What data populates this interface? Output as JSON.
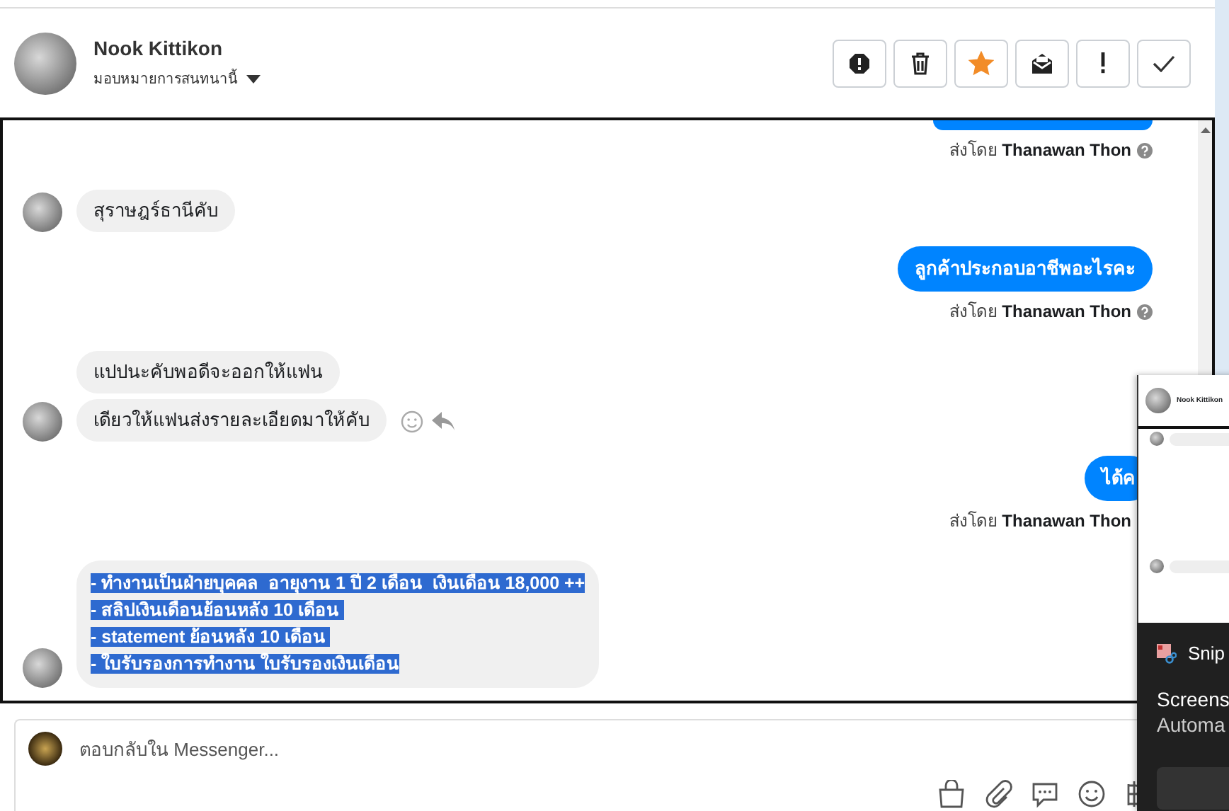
{
  "header": {
    "name": "Nook Kittikon",
    "assign_label": "มอบหมายการสนทนานี้",
    "buttons": [
      {
        "kind": "spam",
        "active": false
      },
      {
        "kind": "delete",
        "active": false
      },
      {
        "kind": "star",
        "active": true
      },
      {
        "kind": "unread",
        "active": false
      },
      {
        "kind": "important",
        "active": false
      },
      {
        "kind": "done",
        "active": false
      }
    ]
  },
  "messages": [
    {
      "kind": "sender",
      "prefix": "ส่งโดย",
      "name": "Thanawan Thon",
      "help": true
    },
    {
      "kind": "incoming",
      "avatar": true,
      "actions": false,
      "selected": false,
      "lines": [
        "สุราษฎร์ธานีคับ"
      ]
    },
    {
      "kind": "outgoing",
      "lines": [
        "ลูกค้าประกอบอาชีพอะไรคะ"
      ]
    },
    {
      "kind": "sender",
      "prefix": "ส่งโดย",
      "name": "Thanawan Thon",
      "help": true
    },
    {
      "kind": "incoming",
      "avatar": false,
      "actions": false,
      "selected": false,
      "lines": [
        "แปปนะคับพอดีจะออกให้แฟน"
      ]
    },
    {
      "kind": "incoming",
      "avatar": true,
      "actions": true,
      "selected": false,
      "lines": [
        "เดียวให้แฟนส่งรายละเอียดมาให้คับ"
      ]
    },
    {
      "kind": "outgoing",
      "lines": [
        "ได้ค"
      ]
    },
    {
      "kind": "sender",
      "prefix": "ส่งโดย",
      "name": "Thanawan Thon"
    },
    {
      "kind": "incoming",
      "avatar": true,
      "actions": false,
      "selected": true,
      "lines": [
        "- ทำงานเป็นฝ่ายบุคคล  อายุงาน 1 ปี 2 เดือน  เงินเดือน 18,000 ++",
        "- สลิปเงินเดือนย้อนหลัง 10 เดือน ",
        "- statement ย้อนหลัง 10 เดือน ",
        "- ใบรับรองการทำงาน ใบรับรองเงินเดือน"
      ]
    }
  ],
  "composer": {
    "placeholder": "ตอบกลับใน Messenger..."
  },
  "overlay": {
    "preview_title": "Nook Kittikon",
    "app": "Snip",
    "title": "Screens",
    "subtitle": "Automa"
  }
}
